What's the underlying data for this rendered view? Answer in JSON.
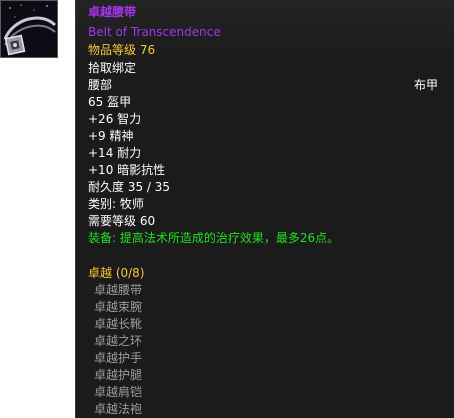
{
  "item": {
    "name_cn": "卓越腰带",
    "name_en": "Belt of Transcendence",
    "item_level": "物品等级 76",
    "bind": "拾取绑定",
    "slot": "腰部",
    "armor_type": "布甲",
    "armor": "65 盔甲",
    "stats": [
      "+26 智力",
      "+9 精神",
      "+14 耐力",
      "+10 暗影抗性"
    ],
    "durability": "耐久度 35 / 35",
    "class_req": "类别: 牧师",
    "level_req": "需要等级 60",
    "equip_effect": "装备: 提高法术所造成的治疗效果，最多26点。",
    "icon": "belt-icon"
  },
  "set": {
    "title": "卓越 (0/8)",
    "pieces": [
      "卓越腰带",
      "卓越束腕",
      "卓越长靴",
      "卓越之环",
      "卓越护手",
      "卓越护腿",
      "卓越肩铠",
      "卓越法袍"
    ]
  },
  "colors": {
    "epic": "#a535ee",
    "set_title": "#f8c73a",
    "equip": "#20e020",
    "inactive": "#9d9d9d",
    "tooltip_bg": "#1b1b1b"
  }
}
